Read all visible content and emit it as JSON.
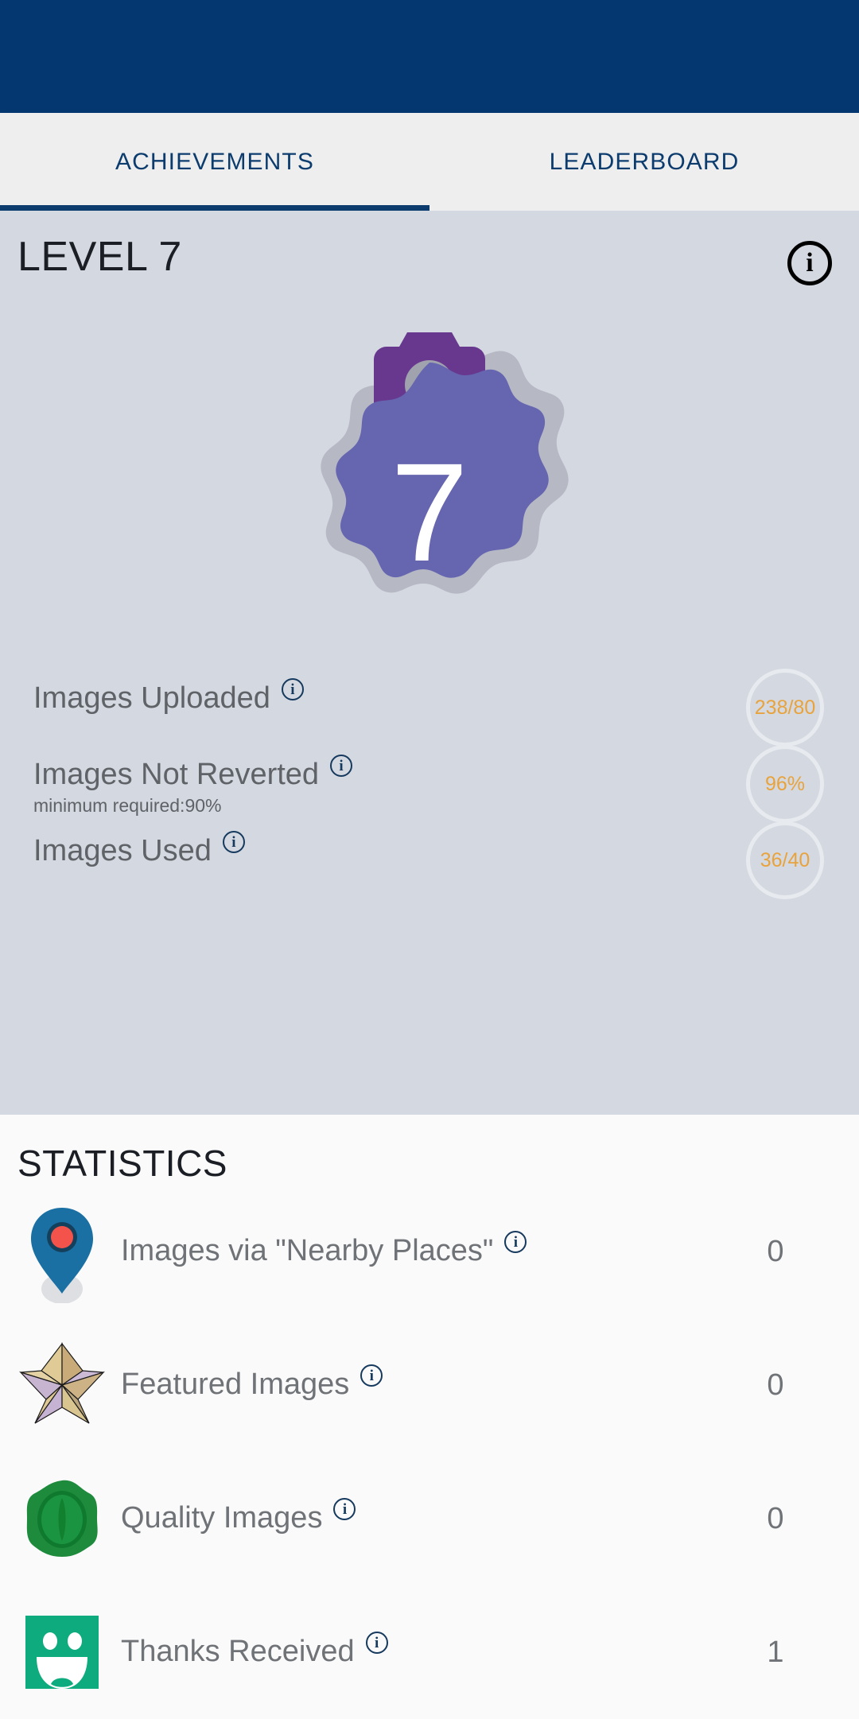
{
  "statusbar": {
    "color": "#043670"
  },
  "tabs": [
    {
      "label": "ACHIEVEMENTS",
      "selected": true
    },
    {
      "label": "LEADERBOARD",
      "selected": false
    }
  ],
  "achievements": {
    "level_title": "LEVEL 7",
    "info_icon": "info-icon",
    "info_glyph": "i",
    "badge": {
      "number": "7",
      "fill_color": "#6565b0",
      "outline_color": "#b6b8c4",
      "camera_color": "#68388f",
      "lens_color": "#a0a2ae"
    },
    "rows": [
      {
        "label": "Images Uploaded",
        "sublabel": "",
        "value": "238/80",
        "info_glyph": "i"
      },
      {
        "label": "Images Not Reverted",
        "sublabel": "minimum required:90%",
        "value": "96%",
        "info_glyph": "i"
      },
      {
        "label": "Images Used",
        "sublabel": "",
        "value": "36/40",
        "info_glyph": "i"
      }
    ],
    "value_color": "#e8a33d",
    "ring_color": "#e7eaee"
  },
  "statistics": {
    "title": "STATISTICS",
    "rows": [
      {
        "icon": "map-pin-icon",
        "label": "Images via \"Nearby Places\"",
        "value": "0",
        "info_glyph": "i"
      },
      {
        "icon": "star-icon",
        "label": "Featured Images",
        "value": "0",
        "info_glyph": "i"
      },
      {
        "icon": "wax-seal-icon",
        "label": "Quality Images",
        "value": "0",
        "info_glyph": "i"
      },
      {
        "icon": "smiley-thanks-icon",
        "label": "Thanks Received",
        "value": "1",
        "info_glyph": "i"
      }
    ]
  }
}
